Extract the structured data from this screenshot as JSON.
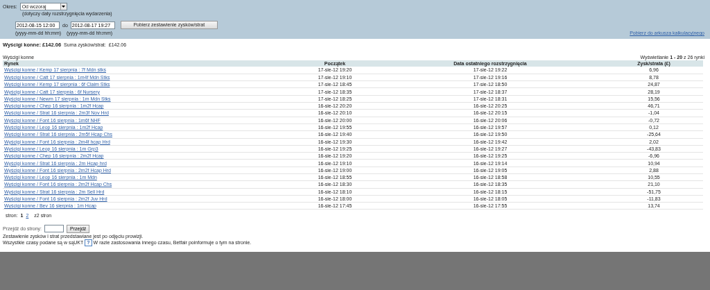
{
  "filter": {
    "period_label": "Okres:",
    "period_value": "Od wczoraj",
    "period_note": "(dotyczy daty rozstrzygnięcia wydarzenia)",
    "from_value": "2012-08-15 12:00",
    "to_label": "do",
    "to_value": "2012-08-17 19:27",
    "from_hint": "(yyyy-mm-dd hh:mm)",
    "to_hint": "(yyyy-mm-dd hh:mm)",
    "submit": "Pobierz zestawienie zysków/strat",
    "download_link": "Pobierz do arkusza kalkulacyjnego"
  },
  "summary": {
    "label": "Wyścigi konne: £142.06",
    "sum_label": "Suma zysków/strat:",
    "sum_value": "£142.06"
  },
  "table": {
    "caption": "Wyścigi konne",
    "range": "Wyświetlanie **1 - 20** z 26 rynki",
    "columns": [
      "Rynek",
      "Początek",
      "Data ostatniego rozstrzygnięcia",
      "Zysk/strata (£)"
    ],
    "rows": [
      [
        "Wyścigi konne / Kemp 17 sierpnia : 7f Mdn stks",
        "17-sie-12 19:20",
        "17-sie-12 19:22",
        "6,96"
      ],
      [
        "Wyścigi konne / Catt 17 sierpnia : 1m4f Mdn Stks",
        "17-sie-12 19:10",
        "17-sie-12 19:16",
        "8,78"
      ],
      [
        "Wyścigi konne / Kemp 17 sierpnia : 6f Claim Stks",
        "17-sie-12 18:45",
        "17-sie-12 18:50",
        "24,87"
      ],
      [
        "Wyścigi konne / Catt 17 sierpnia : 6f Nursery",
        "17-sie-12 18:35",
        "17-sie-12 18:37",
        "28,19"
      ],
      [
        "Wyścigi konne / Newm 17 sierpnia : 1m Mdn Stks",
        "17-sie-12 18:25",
        "17-sie-12 18:31",
        "15,56"
      ],
      [
        "Wyścigi konne / Chep 16 sierpnia : 1m2f Hcap",
        "16-sie-12 20:20",
        "16-sie-12 20:25",
        "46,71"
      ],
      [
        "Wyścigi konne / Strat 16 sierpnia : 2m3f Nov Hrd",
        "16-sie-12 20:10",
        "16-sie-12 20:15",
        "-1,04"
      ],
      [
        "Wyścigi konne / Font 16 sierpnia : 1m6f NHF",
        "16-sie-12 20:00",
        "16-sie-12 20:06",
        "-0,72"
      ],
      [
        "Wyścigi konne / Leop 16 sierpnia : 1m2f Hcap",
        "16-sie-12 19:55",
        "16-sie-12 19:57",
        "0,12"
      ],
      [
        "Wyścigi konne / Strat 16 sierpnia : 2m5f Hcap Chs",
        "16-sie-12 19:40",
        "16-sie-12 19:50",
        "-25,64"
      ],
      [
        "Wyścigi konne / Font 16 sierpnia : 2m4f hcap Hrd",
        "16-sie-12 19:30",
        "16-sie-12 19:42",
        "2,02"
      ],
      [
        "Wyścigi konne / Leop 16 sierpnia : 1m Grp3",
        "16-sie-12 19:25",
        "16-sie-12 19:27",
        "-43,83"
      ],
      [
        "Wyścigi konne / Chep 16 sierpnia : 2m2f Hcap",
        "16-sie-12 19:20",
        "16-sie-12 19:25",
        "-6,96"
      ],
      [
        "Wyścigi konne / Strat 16 sierpnia : 2m Hcap hrd",
        "16-sie-12 19:10",
        "16-sie-12 19:14",
        "10,94"
      ],
      [
        "Wyścigi konne / Font 16 sierpnia : 2m2f Hcap Hrd",
        "16-sie-12 19:00",
        "16-sie-12 19:05",
        "2,88"
      ],
      [
        "Wyścigi konne / Leop 16 sierpnia : 1m Mdn",
        "16-sie-12 18:55",
        "16-sie-12 18:58",
        "10,55"
      ],
      [
        "Wyścigi konne / Font 16 sierpnia : 2m2f Hcap Chs",
        "16-sie-12 18:30",
        "16-sie-12 18:35",
        "21,10"
      ],
      [
        "Wyścigi konne / Strat 16 sierpnia : 2m Sell Hrd",
        "16-sie-12 18:10",
        "16-sie-12 18:15",
        "-51,75"
      ],
      [
        "Wyścigi konne / Font 16 sierpnia : 2m2f Juv Hrd",
        "16-sie-12 18:00",
        "16-sie-12 18:05",
        "-11,83"
      ],
      [
        "Wyścigi konne / Bev 16 sierpnia : 1m Hcap",
        "16-sie-12 17:45",
        "16-sie-12 17:55",
        "13,74"
      ]
    ]
  },
  "pagination": {
    "label": "stron:",
    "pages": [
      {
        "label": "1",
        "selected": true
      },
      {
        "label": "2",
        "selected": false
      }
    ],
    "total": "z2 stron"
  },
  "goto": {
    "label": "Przejdź do strony:",
    "button": "Przejdź"
  },
  "notes": {
    "line_1": "Zestawienie zysków i strat przedstawiane jest po odjęciu prowizji.",
    "line_2_before": "Wszystkie czasy podane są w sąUKT",
    "help": "?",
    "line_2_after": "W razie zastosowania innego czasu, Betfair poinformuje o tym na stronie."
  }
}
